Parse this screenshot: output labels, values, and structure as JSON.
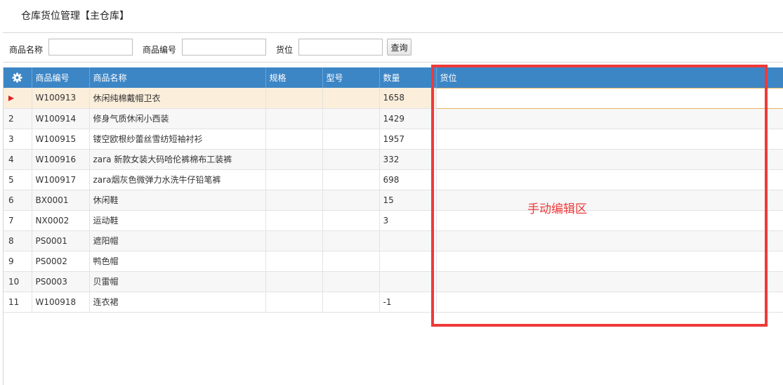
{
  "page": {
    "title": "仓库货位管理【主仓库】"
  },
  "search": {
    "name_label": "商品名称",
    "name_value": "",
    "code_label": "商品编号",
    "code_value": "",
    "location_label": "货位",
    "location_value": "",
    "query_button": "查询"
  },
  "grid": {
    "settings_icon": "gear-icon",
    "header_color": "#3d86c6",
    "columns": [
      "商品编号",
      "商品名称",
      "规格",
      "型号",
      "数量",
      "货位"
    ],
    "rows": [
      {
        "num": "",
        "code": "W100913",
        "name": "休闲纯棉戴帽卫衣",
        "spec": "",
        "model": "",
        "qty": "1658",
        "location": "",
        "selected": true
      },
      {
        "num": "2",
        "code": "W100914",
        "name": "修身气质休闲小西装",
        "spec": "",
        "model": "",
        "qty": "1429",
        "location": ""
      },
      {
        "num": "3",
        "code": "W100915",
        "name": "镂空欧根纱蕾丝雪纺短袖衬衫",
        "spec": "",
        "model": "",
        "qty": "1957",
        "location": ""
      },
      {
        "num": "4",
        "code": "W100916",
        "name": "zara 新款女装大码哈伦裤棉布工装裤",
        "spec": "",
        "model": "",
        "qty": "332",
        "location": ""
      },
      {
        "num": "5",
        "code": "W100917",
        "name": "zara烟灰色微弹力水洗牛仔铅笔裤",
        "spec": "",
        "model": "",
        "qty": "698",
        "location": ""
      },
      {
        "num": "6",
        "code": "BX0001",
        "name": "休闲鞋",
        "spec": "",
        "model": "",
        "qty": "15",
        "location": ""
      },
      {
        "num": "7",
        "code": "NX0002",
        "name": "运动鞋",
        "spec": "",
        "model": "",
        "qty": "3",
        "location": ""
      },
      {
        "num": "8",
        "code": "PS0001",
        "name": "遮阳帽",
        "spec": "",
        "model": "",
        "qty": "",
        "location": ""
      },
      {
        "num": "9",
        "code": "PS0002",
        "name": "鸭色帽",
        "spec": "",
        "model": "",
        "qty": "",
        "location": ""
      },
      {
        "num": "10",
        "code": "PS0003",
        "name": "贝雷帽",
        "spec": "",
        "model": "",
        "qty": "",
        "location": ""
      },
      {
        "num": "11",
        "code": "W100918",
        "name": "连衣裙",
        "spec": "",
        "model": "",
        "qty": "-1",
        "location": ""
      }
    ]
  },
  "annotation": {
    "label": "手动编辑区",
    "color": "#ee3a3a"
  }
}
